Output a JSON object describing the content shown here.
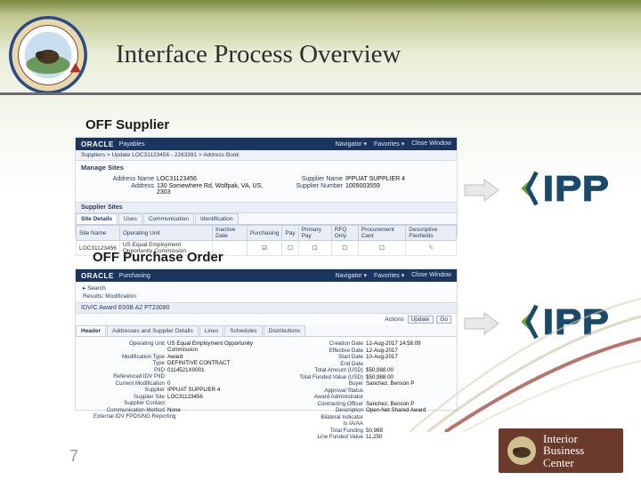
{
  "title": "Interface Process Overview",
  "page_number": "7",
  "ibc": {
    "line1": "Interior",
    "line2": "Business",
    "line3": "Center"
  },
  "sections": {
    "supplier_label": "OFF Supplier",
    "po_label": "OFF Purchase Order"
  },
  "oracle": {
    "brand": "ORACLE",
    "app_payables": "Payables",
    "app_purchasing": "Purchasing",
    "nav_items": [
      "Navigator ▾",
      "Favorites ▾"
    ],
    "close": "Close Window"
  },
  "supplier_panel": {
    "breadcrumb": "Suppliers > Update LOC31123456 - 2263391 > Address Book",
    "manage_sites": "Manage Sites",
    "details": {
      "address_name_label": "Address Name",
      "address_name": "LOC31123456",
      "address_label": "Address",
      "address": "130 Somewhere Rd, Wolfpak, VA, US, 2303",
      "supplier_name_label": "Supplier Name",
      "supplier_name": "IPPUAT SUPPLIER 4",
      "supplier_num_label": "Supplier Number",
      "supplier_num": "1009003559"
    },
    "supplier_sites": "Supplier Sites",
    "tabs": [
      "Site Details",
      "Uses",
      "Communication",
      "Identification"
    ],
    "grid": {
      "headers": [
        "Site Name",
        "Operating Unit",
        "Inactive Date",
        "Purchasing",
        "Pay",
        "Primary Pay",
        "RFQ Only",
        "Procurement Card",
        "Descriptive Flexfields"
      ],
      "row": [
        "LOC31123456",
        "US Equal Employment Opportunity Commission",
        "",
        "☑",
        "☐",
        "☐",
        "☐",
        "☐",
        ""
      ]
    }
  },
  "po_panel": {
    "search_toggle": "▸ Search",
    "results_label": "Results: Modification",
    "award_title": "IDV/C Award E00B A2 PT23080",
    "tabs": [
      "Header",
      "Addresses and Supplier Details",
      "Lines",
      "Schedules",
      "Distributions"
    ],
    "action_label": "Actions",
    "action_select": "Update",
    "action_go": "Go",
    "left": {
      "operating_unit_label": "Operating Unit",
      "operating_unit": "US Equal Employment Opportunity Commission",
      "mod_type_label": "Modification Type",
      "mod_type": "Award",
      "type_label": "Type",
      "type": "DEFINITIVE CONTRACT",
      "piid_label": "PIID",
      "piid": "0114521X0001",
      "reference_label": "Referenced IDV PIID",
      "reference": "",
      "revision_label": "Current Modification",
      "revision": "0",
      "supplier_label": "Supplier",
      "supplier": "IPPUAT SUPPLIER 4",
      "supplier_site_label": "Supplier Site",
      "supplier_site": "LOC31123456",
      "supplier_contact_label": "Supplier Contact",
      "supplier_contact": "",
      "comm_method_label": "Communication Method",
      "comm_method": "None",
      "fpds_label": "External IDV FPDS/NG Reporting",
      "fpds": ""
    },
    "right": {
      "creation_date_label": "Creation Date",
      "creation_date": "12-Aug-2017 14:58:09",
      "effective_date_label": "Effective Date",
      "effective_date": "12-Aug-2017",
      "start_date_label": "Start Date",
      "start_date": "10-Aug-2017",
      "end_date_label": "End Date",
      "end_date": "",
      "total_label": "Total Amount (USD)",
      "total": "$50,988.00",
      "funded_label": "Total Funded Value (USD)",
      "funded": "$50,988.00",
      "buyer_label": "Buyer",
      "buyer": "Sanchez, Benson P",
      "approval_status_label": "Approval Status",
      "approval_status": "",
      "award_admin_label": "Award Administrator",
      "award_admin": "",
      "co_label": "Contracting Officer",
      "co": "Sanchez, Benson P",
      "desc_label": "Description",
      "desc": "Open-Net Shared Award",
      "bilateral_label": "Bilateral Indicator",
      "bilateral": "",
      "ia_label": "Is IA/AA",
      "ia": "",
      "funding_label": "Total Funding",
      "funding": "50,988",
      "line_funded_label": "Line Funded Value",
      "line_funded": "11,250"
    }
  }
}
